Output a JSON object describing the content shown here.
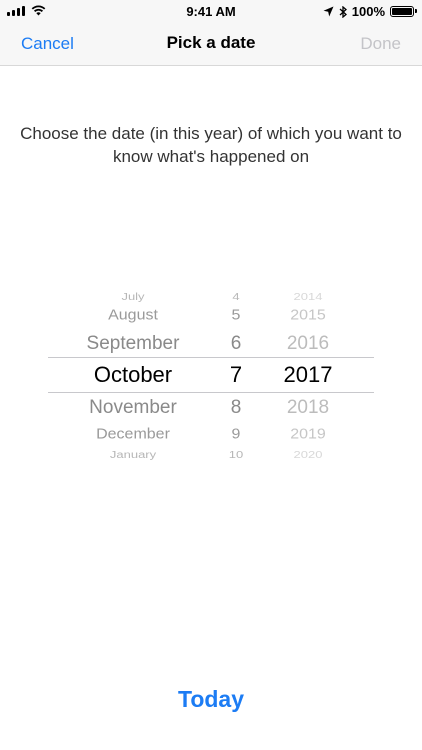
{
  "status_bar": {
    "time": "9:41 AM",
    "battery": "100%"
  },
  "nav": {
    "cancel": "Cancel",
    "title": "Pick a date",
    "done": "Done"
  },
  "instruction": "Choose the date (in this year) of which you want to know what's happened on",
  "picker": {
    "months": [
      "July",
      "August",
      "September",
      "October",
      "November",
      "December",
      "January"
    ],
    "days": [
      "4",
      "5",
      "6",
      "7",
      "8",
      "9",
      "10"
    ],
    "years": [
      "2014",
      "2015",
      "2016",
      "2017",
      "2018",
      "2019",
      "2020"
    ],
    "selected": {
      "month": "October",
      "day": "7",
      "year": "2017"
    }
  },
  "today_button": "Today"
}
